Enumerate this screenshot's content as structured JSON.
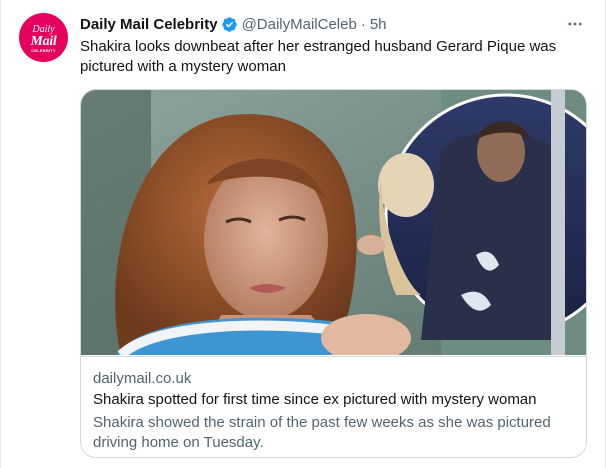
{
  "tweet": {
    "avatar": {
      "line1": "Daily",
      "line2": "Mail",
      "line3": "CELEBRITY"
    },
    "author_name": "Daily Mail Celebrity",
    "handle": "@DailyMailCeleb",
    "separator": "·",
    "time": "5h",
    "text": "Shakira looks downbeat after her estranged husband Gerard Pique was pictured with a mystery woman",
    "icons": {
      "verified": "verified-badge-icon",
      "more": "more-options-icon"
    }
  },
  "card": {
    "domain": "dailymail.co.uk",
    "title": "Shakira spotted for first time since ex pictured with mystery woman",
    "description": "Shakira showed the strain of the past few weeks as she was pictured driving home on Tuesday."
  },
  "colors": {
    "brand": "#e5005d",
    "verified": "#1d9bf0",
    "secondary_text": "#536471",
    "border": "#cfd9de"
  }
}
